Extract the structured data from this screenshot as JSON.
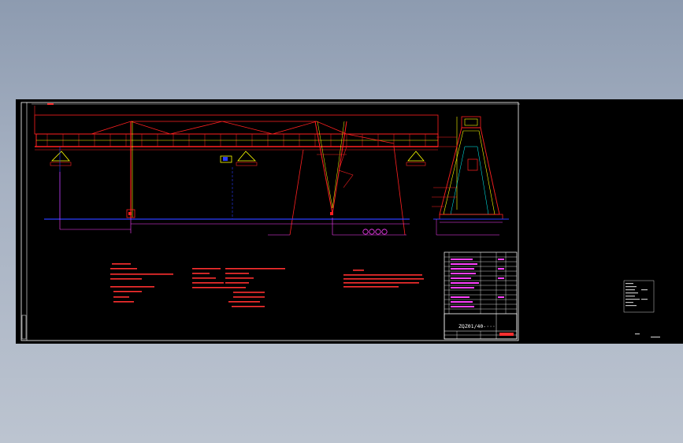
{
  "colors": {
    "background_top": "#8d9bb0",
    "background_bottom": "#bcc4d0",
    "sheet": "#000000",
    "border": "#ffffff",
    "structure_red": "#ff2020",
    "structure_yellow": "#ffff00",
    "rail_blue": "#2a3cff",
    "dimension_magenta": "#ff40ff",
    "centerline": "#00ffff",
    "text_red": "#ff3030",
    "table_white": "#ffffff"
  },
  "title_block": {
    "drawing_number": "ZQZ01/40-···"
  },
  "icons": {
    "wheel_set": "wheel-circles",
    "hook": "hook-marker"
  }
}
